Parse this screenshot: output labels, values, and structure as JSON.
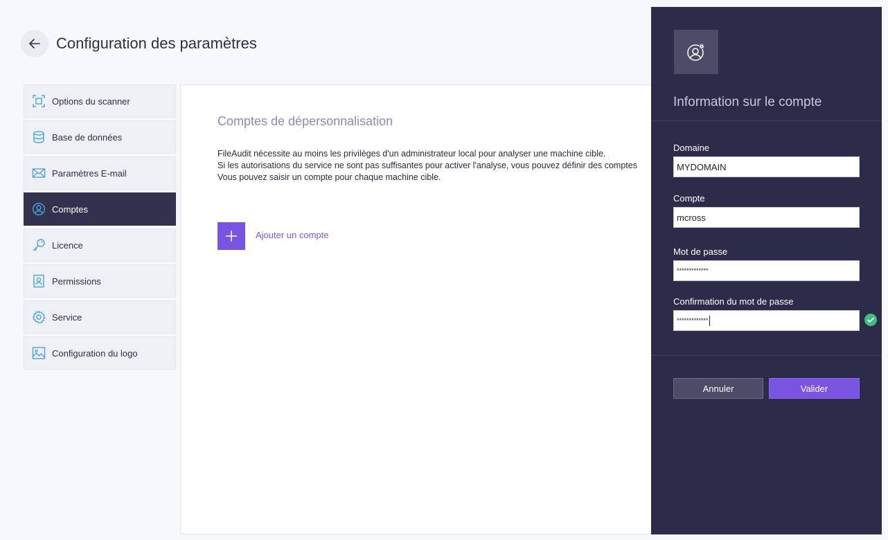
{
  "header": {
    "back_icon": "arrow-left-icon",
    "title": "Configuration des paramètres"
  },
  "sidebar": {
    "items": [
      {
        "label": "Options du scanner",
        "icon": "scanner-frame-icon",
        "active": false
      },
      {
        "label": "Base de données",
        "icon": "database-icon",
        "active": false
      },
      {
        "label": "Paramètres E-mail",
        "icon": "envelope-icon",
        "active": false
      },
      {
        "label": "Comptes",
        "icon": "user-circle-icon",
        "active": true
      },
      {
        "label": "Licence",
        "icon": "key-icon",
        "active": false
      },
      {
        "label": "Permissions",
        "icon": "badge-icon",
        "active": false
      },
      {
        "label": "Service",
        "icon": "gear-icon",
        "active": false
      },
      {
        "label": "Configuration du logo",
        "icon": "image-icon",
        "active": false
      }
    ]
  },
  "main": {
    "title": "Comptes de dépersonnalisation",
    "description": [
      "FileAudit nécessite au moins les privilèges d'un administrateur local pour analyser une machine cible.",
      "Si les autorisations du service ne sont pas suffisantes pour activer l'analyse, vous pouvez définir des comptes",
      "Vous pouvez saisir un compte pour chaque machine cible."
    ],
    "add_account_label": "Ajouter un compte"
  },
  "panel": {
    "icon": "user-settings-icon",
    "title": "Information sur le compte",
    "fields": {
      "domain": {
        "label": "Domaine",
        "value": "MYDOMAIN"
      },
      "account": {
        "label": "Compte",
        "value": "mcross"
      },
      "password": {
        "label": "Mot de passe",
        "value": "*************"
      },
      "confirm": {
        "label": "Confirmation du mot de passe",
        "value": "*************"
      }
    },
    "confirm_status_icon": "check-circle-icon",
    "cancel_label": "Annuler",
    "ok_label": "Valider"
  },
  "colors": {
    "accent": "#7954e0",
    "panel_bg": "#2c2b49",
    "active_nav": "#33324e",
    "icon_blue": "#4aa3df",
    "success": "#3fbf7f"
  }
}
